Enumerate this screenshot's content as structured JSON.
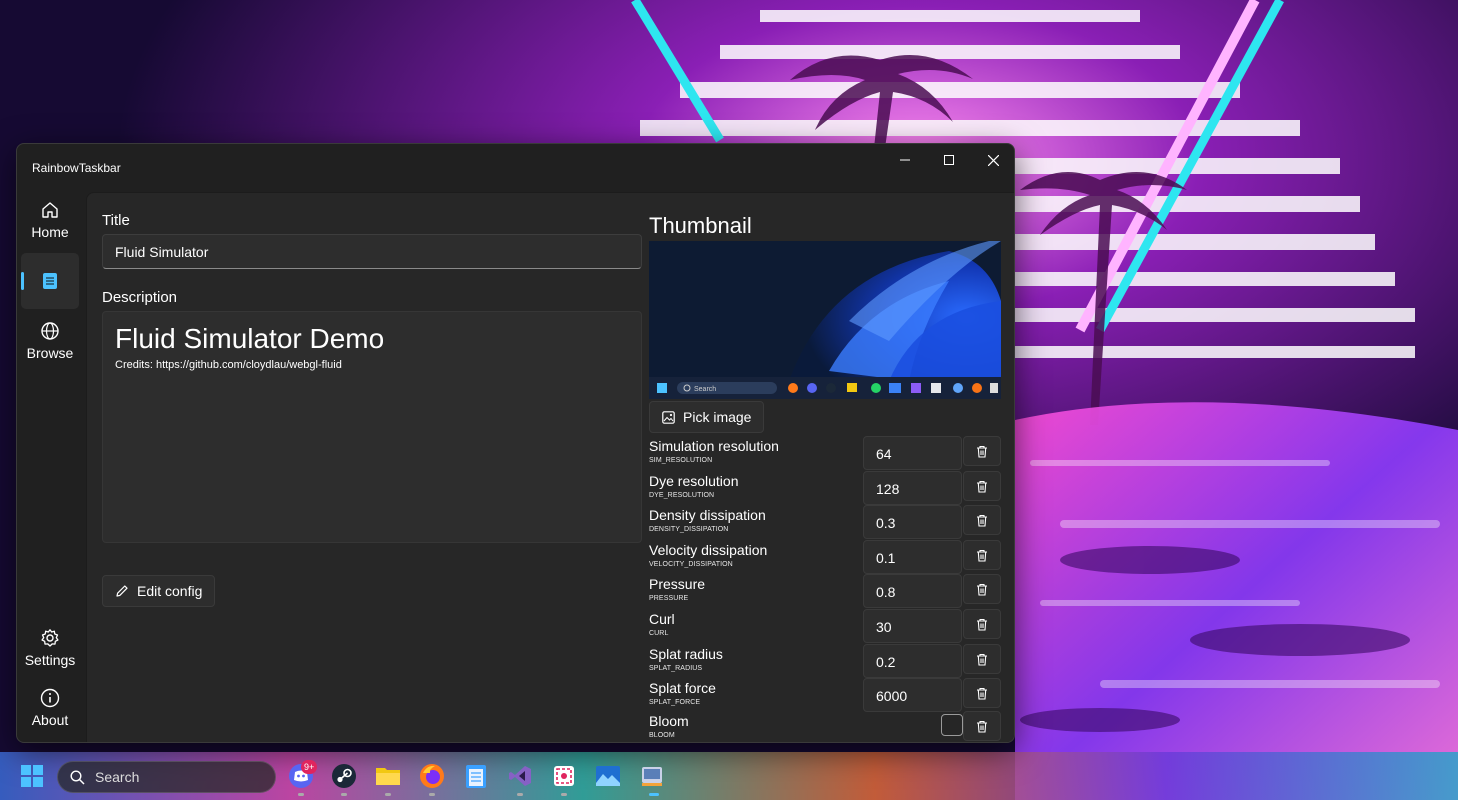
{
  "window": {
    "title": "RainbowTaskbar",
    "controls": [
      "minimize-icon",
      "maximize-icon",
      "close-icon"
    ]
  },
  "nav": {
    "items": [
      {
        "label": "Home",
        "icon": "home-icon"
      },
      {
        "label": "",
        "icon": "document-icon",
        "selected": true
      },
      {
        "label": "Browse",
        "icon": "globe-icon"
      }
    ],
    "footer": [
      {
        "label": "Settings",
        "icon": "gear-icon"
      },
      {
        "label": "About",
        "icon": "info-icon"
      }
    ]
  },
  "editor": {
    "title_label": "Title",
    "title_value": "Fluid Simulator",
    "description_label": "Description",
    "description_heading": "Fluid Simulator Demo",
    "description_credits": "Credits: https://github.com/cloydlau/webgl-fluid",
    "edit_config_label": "Edit config"
  },
  "thumbnail": {
    "heading": "Thumbnail",
    "pick_image_label": "Pick image",
    "preview_search": "Search"
  },
  "settings": [
    {
      "name": "Simulation resolution",
      "key": "SIM_RESOLUTION",
      "value": "64"
    },
    {
      "name": "Dye resolution",
      "key": "DYE_RESOLUTION",
      "value": "128"
    },
    {
      "name": "Density dissipation",
      "key": "DENSITY_DISSIPATION",
      "value": "0.3"
    },
    {
      "name": "Velocity dissipation",
      "key": "VELOCITY_DISSIPATION",
      "value": "0.1"
    },
    {
      "name": "Pressure",
      "key": "PRESSURE",
      "value": "0.8"
    },
    {
      "name": "Curl",
      "key": "CURL",
      "value": "30"
    },
    {
      "name": "Splat radius",
      "key": "SPLAT_RADIUS",
      "value": "0.2"
    },
    {
      "name": "Splat force",
      "key": "SPLAT_FORCE",
      "value": "6000"
    },
    {
      "name": "Bloom",
      "key": "BLOOM",
      "checked": false
    }
  ],
  "taskbar": {
    "search_placeholder": "Search",
    "discord_badge": "9+",
    "apps": [
      "windows-start-icon",
      "discord-icon",
      "steam-icon",
      "file-explorer-icon",
      "firefox-icon",
      "notepad-icon",
      "visual-studio-icon",
      "snipping-tool-icon",
      "photos-icon",
      "rainbowtaskbar-icon"
    ]
  },
  "colors": {
    "accent": "#4cc2ff",
    "window_bg": "#202020",
    "content_bg": "#272727",
    "control_bg": "#2d2d2d"
  }
}
